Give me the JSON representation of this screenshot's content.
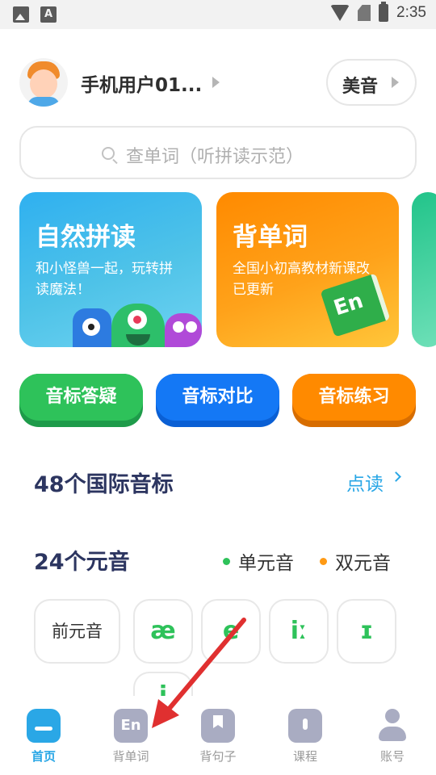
{
  "status_bar": {
    "time": "2:35"
  },
  "header": {
    "username": "手机用户01...",
    "accent_button": "美音"
  },
  "search": {
    "placeholder": "查单词（听拼读示范）"
  },
  "cards": [
    {
      "title": "自然拼读",
      "subtitle": "和小怪兽一起，玩转拼读魔法！"
    },
    {
      "title": "背单词",
      "subtitle": "全国小初高教材新课改已更新",
      "badge_text": "En"
    }
  ],
  "pills": [
    "音标答疑",
    "音标对比",
    "音标练习"
  ],
  "phonetics": {
    "title": "48个国际音标",
    "link": "点读",
    "vowel_title": "24个元音",
    "legend": [
      {
        "label": "单元音",
        "color": "#2ec25a"
      },
      {
        "label": "双元音",
        "color": "#ff9a14"
      }
    ],
    "category_tile": "前元音",
    "symbols": [
      "æ",
      "e",
      "iː",
      "ɪ",
      "i"
    ]
  },
  "bottom_nav": [
    {
      "label": "首页",
      "icon": "home-icon",
      "active": true
    },
    {
      "label": "背单词",
      "icon": "en-book-icon",
      "icon_text": "En"
    },
    {
      "label": "背句子",
      "icon": "bookmark-icon"
    },
    {
      "label": "课程",
      "icon": "course-icon"
    },
    {
      "label": "账号",
      "icon": "account-icon"
    }
  ],
  "colors": {
    "primary_blue": "#2aa7e6",
    "green": "#2ec25a",
    "orange": "#ff8a00",
    "annotation_red": "#e03030"
  }
}
